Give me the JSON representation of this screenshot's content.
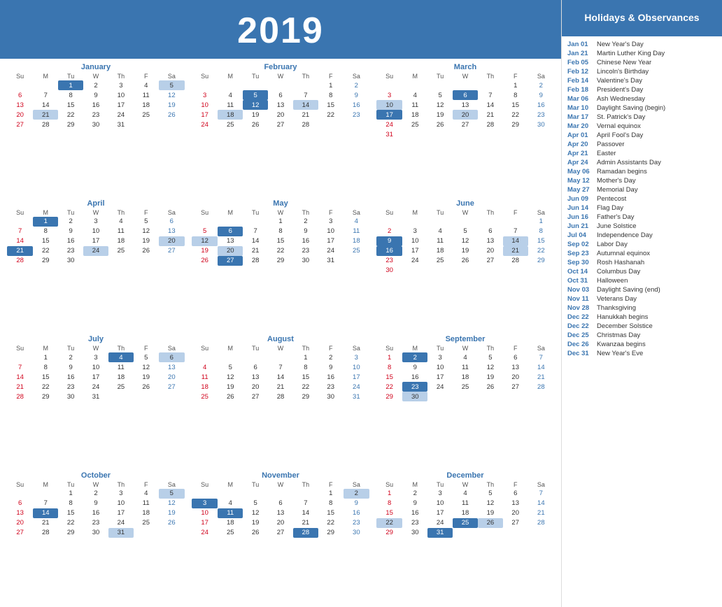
{
  "year": "2019",
  "sidebar": {
    "header": "Holidays & Observances",
    "holidays": [
      {
        "date": "Jan 01",
        "name": "New Year's Day"
      },
      {
        "date": "Jan 21",
        "name": "Martin Luther King Day"
      },
      {
        "date": "Feb 05",
        "name": "Chinese New Year"
      },
      {
        "date": "Feb 12",
        "name": "Lincoln's Birthday"
      },
      {
        "date": "Feb 14",
        "name": "Valentine's Day"
      },
      {
        "date": "Feb 18",
        "name": "President's Day"
      },
      {
        "date": "Mar 06",
        "name": "Ash Wednesday"
      },
      {
        "date": "Mar 10",
        "name": "Daylight Saving (begin)"
      },
      {
        "date": "Mar 17",
        "name": "St. Patrick's Day"
      },
      {
        "date": "Mar 20",
        "name": "Vernal equinox"
      },
      {
        "date": "Apr 01",
        "name": "April Fool's Day"
      },
      {
        "date": "Apr 20",
        "name": "Passover"
      },
      {
        "date": "Apr 21",
        "name": "Easter"
      },
      {
        "date": "Apr 24",
        "name": "Admin Assistants Day"
      },
      {
        "date": "May 06",
        "name": "Ramadan begins"
      },
      {
        "date": "May 12",
        "name": "Mother's Day"
      },
      {
        "date": "May 27",
        "name": "Memorial Day"
      },
      {
        "date": "Jun 09",
        "name": "Pentecost"
      },
      {
        "date": "Jun 14",
        "name": "Flag Day"
      },
      {
        "date": "Jun 16",
        "name": "Father's Day"
      },
      {
        "date": "Jun 21",
        "name": "June Solstice"
      },
      {
        "date": "Jul 04",
        "name": "Independence Day"
      },
      {
        "date": "Sep 02",
        "name": "Labor Day"
      },
      {
        "date": "Sep 23",
        "name": "Autumnal equinox"
      },
      {
        "date": "Sep 30",
        "name": "Rosh Hashanah"
      },
      {
        "date": "Oct 14",
        "name": "Columbus Day"
      },
      {
        "date": "Oct 31",
        "name": "Halloween"
      },
      {
        "date": "Nov 03",
        "name": "Daylight Saving (end)"
      },
      {
        "date": "Nov 11",
        "name": "Veterans Day"
      },
      {
        "date": "Nov 28",
        "name": "Thanksgiving"
      },
      {
        "date": "Dec 22",
        "name": "Hanukkah begins"
      },
      {
        "date": "Dec 22",
        "name": "December Solstice"
      },
      {
        "date": "Dec 25",
        "name": "Christmas Day"
      },
      {
        "date": "Dec 26",
        "name": "Kwanzaa begins"
      },
      {
        "date": "Dec 31",
        "name": "New Year's Eve"
      }
    ]
  },
  "months": [
    {
      "name": "January",
      "headers": [
        "Su",
        "M",
        "Tu",
        "W",
        "Th",
        "F",
        "Sa"
      ],
      "weeks": [
        [
          "",
          "",
          "1",
          "2",
          "3",
          "4",
          "5"
        ],
        [
          "6",
          "7",
          "8",
          "9",
          "10",
          "11",
          "12"
        ],
        [
          "13",
          "14",
          "15",
          "16",
          "17",
          "18",
          "19"
        ],
        [
          "20",
          "21",
          "22",
          "23",
          "24",
          "25",
          "26"
        ],
        [
          "27",
          "28",
          "29",
          "30",
          "31",
          "",
          ""
        ]
      ],
      "highlights": {
        "dark": [
          "1"
        ],
        "blue": [
          "5",
          "21"
        ]
      }
    },
    {
      "name": "February",
      "headers": [
        "Su",
        "M",
        "Tu",
        "W",
        "Th",
        "F",
        "Sa"
      ],
      "weeks": [
        [
          "",
          "",
          "",
          "",
          "",
          "1",
          "2"
        ],
        [
          "3",
          "4",
          "5",
          "6",
          "7",
          "8",
          "9"
        ],
        [
          "10",
          "11",
          "12",
          "13",
          "14",
          "15",
          "16"
        ],
        [
          "17",
          "18",
          "19",
          "20",
          "21",
          "22",
          "23"
        ],
        [
          "24",
          "25",
          "26",
          "27",
          "28",
          "",
          ""
        ]
      ],
      "highlights": {
        "dark": [
          "5",
          "12"
        ],
        "blue": [
          "14",
          "18"
        ]
      }
    },
    {
      "name": "March",
      "headers": [
        "Su",
        "M",
        "Tu",
        "W",
        "Th",
        "F",
        "Sa"
      ],
      "weeks": [
        [
          "",
          "",
          "",
          "",
          "",
          "1",
          "2"
        ],
        [
          "3",
          "4",
          "5",
          "6",
          "7",
          "8",
          "9"
        ],
        [
          "10",
          "11",
          "12",
          "13",
          "14",
          "15",
          "16"
        ],
        [
          "17",
          "18",
          "19",
          "20",
          "21",
          "22",
          "23"
        ],
        [
          "24",
          "25",
          "26",
          "27",
          "28",
          "29",
          "30"
        ],
        [
          "31",
          "",
          "",
          "",
          "",
          "",
          ""
        ]
      ],
      "highlights": {
        "dark": [
          "6",
          "17"
        ],
        "blue": [
          "10",
          "20"
        ]
      }
    },
    {
      "name": "April",
      "headers": [
        "Su",
        "M",
        "Tu",
        "W",
        "Th",
        "F",
        "Sa"
      ],
      "weeks": [
        [
          "",
          "1",
          "2",
          "3",
          "4",
          "5",
          "6"
        ],
        [
          "7",
          "8",
          "9",
          "10",
          "11",
          "12",
          "13"
        ],
        [
          "14",
          "15",
          "16",
          "17",
          "18",
          "19",
          "20"
        ],
        [
          "21",
          "22",
          "23",
          "24",
          "25",
          "26",
          "27"
        ],
        [
          "28",
          "29",
          "30",
          "",
          "",
          "",
          ""
        ]
      ],
      "highlights": {
        "dark": [
          "1",
          "21"
        ],
        "blue": [
          "20",
          "24"
        ]
      }
    },
    {
      "name": "May",
      "headers": [
        "Su",
        "M",
        "Tu",
        "W",
        "Th",
        "F",
        "Sa"
      ],
      "weeks": [
        [
          "",
          "",
          "",
          "1",
          "2",
          "3",
          "4"
        ],
        [
          "5",
          "6",
          "7",
          "8",
          "9",
          "10",
          "11"
        ],
        [
          "12",
          "13",
          "14",
          "15",
          "16",
          "17",
          "18"
        ],
        [
          "19",
          "20",
          "21",
          "22",
          "23",
          "24",
          "25"
        ],
        [
          "26",
          "27",
          "28",
          "29",
          "30",
          "31",
          ""
        ]
      ],
      "highlights": {
        "dark": [
          "6",
          "27"
        ],
        "blue": [
          "12",
          "20"
        ]
      }
    },
    {
      "name": "June",
      "headers": [
        "Su",
        "M",
        "Tu",
        "W",
        "Th",
        "F",
        "Sa"
      ],
      "weeks": [
        [
          "",
          "",
          "",
          "",
          "",
          "",
          "1"
        ],
        [
          "2",
          "3",
          "4",
          "5",
          "6",
          "7",
          "8"
        ],
        [
          "9",
          "10",
          "11",
          "12",
          "13",
          "14",
          "15"
        ],
        [
          "16",
          "17",
          "18",
          "19",
          "20",
          "21",
          "22"
        ],
        [
          "23",
          "24",
          "25",
          "26",
          "27",
          "28",
          "29"
        ],
        [
          "30",
          "",
          "",
          "",
          "",
          "",
          ""
        ]
      ],
      "highlights": {
        "dark": [
          "9",
          "16"
        ],
        "blue": [
          "14",
          "21"
        ]
      }
    },
    {
      "name": "July",
      "headers": [
        "Su",
        "M",
        "Tu",
        "W",
        "Th",
        "F",
        "Sa"
      ],
      "weeks": [
        [
          "",
          "1",
          "2",
          "3",
          "4",
          "5",
          "6"
        ],
        [
          "7",
          "8",
          "9",
          "10",
          "11",
          "12",
          "13"
        ],
        [
          "14",
          "15",
          "16",
          "17",
          "18",
          "19",
          "20"
        ],
        [
          "21",
          "22",
          "23",
          "24",
          "25",
          "26",
          "27"
        ],
        [
          "28",
          "29",
          "30",
          "31",
          "",
          "",
          ""
        ]
      ],
      "highlights": {
        "dark": [
          "4"
        ],
        "blue": [
          "6"
        ]
      }
    },
    {
      "name": "August",
      "headers": [
        "Su",
        "M",
        "Tu",
        "W",
        "Th",
        "F",
        "Sa"
      ],
      "weeks": [
        [
          "",
          "",
          "",
          "",
          "1",
          "2",
          "3"
        ],
        [
          "4",
          "5",
          "6",
          "7",
          "8",
          "9",
          "10"
        ],
        [
          "11",
          "12",
          "13",
          "14",
          "15",
          "16",
          "17"
        ],
        [
          "18",
          "19",
          "20",
          "21",
          "22",
          "23",
          "24"
        ],
        [
          "25",
          "26",
          "27",
          "28",
          "29",
          "30",
          "31"
        ]
      ],
      "highlights": {
        "dark": [],
        "blue": []
      }
    },
    {
      "name": "September",
      "headers": [
        "Su",
        "M",
        "Tu",
        "W",
        "Th",
        "F",
        "Sa"
      ],
      "weeks": [
        [
          "1",
          "2",
          "3",
          "4",
          "5",
          "6",
          "7"
        ],
        [
          "8",
          "9",
          "10",
          "11",
          "12",
          "13",
          "14"
        ],
        [
          "15",
          "16",
          "17",
          "18",
          "19",
          "20",
          "21"
        ],
        [
          "22",
          "23",
          "24",
          "25",
          "26",
          "27",
          "28"
        ],
        [
          "29",
          "30",
          "",
          "",
          "",
          "",
          ""
        ]
      ],
      "highlights": {
        "dark": [
          "2",
          "23"
        ],
        "blue": [
          "30"
        ]
      }
    },
    {
      "name": "October",
      "headers": [
        "Su",
        "M",
        "Tu",
        "W",
        "Th",
        "F",
        "Sa"
      ],
      "weeks": [
        [
          "",
          "",
          "1",
          "2",
          "3",
          "4",
          "5"
        ],
        [
          "6",
          "7",
          "8",
          "9",
          "10",
          "11",
          "12"
        ],
        [
          "13",
          "14",
          "15",
          "16",
          "17",
          "18",
          "19"
        ],
        [
          "20",
          "21",
          "22",
          "23",
          "24",
          "25",
          "26"
        ],
        [
          "27",
          "28",
          "29",
          "30",
          "31",
          "",
          ""
        ]
      ],
      "highlights": {
        "dark": [
          "14"
        ],
        "blue": [
          "5",
          "31"
        ]
      }
    },
    {
      "name": "November",
      "headers": [
        "Su",
        "M",
        "Tu",
        "W",
        "Th",
        "F",
        "Sa"
      ],
      "weeks": [
        [
          "",
          "",
          "",
          "",
          "",
          "1",
          "2"
        ],
        [
          "3",
          "4",
          "5",
          "6",
          "7",
          "8",
          "9"
        ],
        [
          "10",
          "11",
          "12",
          "13",
          "14",
          "15",
          "16"
        ],
        [
          "17",
          "18",
          "19",
          "20",
          "21",
          "22",
          "23"
        ],
        [
          "24",
          "25",
          "26",
          "27",
          "28",
          "29",
          "30"
        ]
      ],
      "highlights": {
        "dark": [
          "3",
          "11",
          "28"
        ],
        "blue": [
          "2",
          "28"
        ]
      }
    },
    {
      "name": "December",
      "headers": [
        "Su",
        "M",
        "Tu",
        "W",
        "Th",
        "F",
        "Sa"
      ],
      "weeks": [
        [
          "1",
          "2",
          "3",
          "4",
          "5",
          "6",
          "7"
        ],
        [
          "8",
          "9",
          "10",
          "11",
          "12",
          "13",
          "14"
        ],
        [
          "15",
          "16",
          "17",
          "18",
          "19",
          "20",
          "21"
        ],
        [
          "22",
          "23",
          "24",
          "25",
          "26",
          "27",
          "28"
        ],
        [
          "29",
          "30",
          "31",
          "",
          "",
          "",
          ""
        ]
      ],
      "highlights": {
        "dark": [
          "25",
          "31"
        ],
        "blue": [
          "22",
          "26"
        ]
      }
    }
  ]
}
